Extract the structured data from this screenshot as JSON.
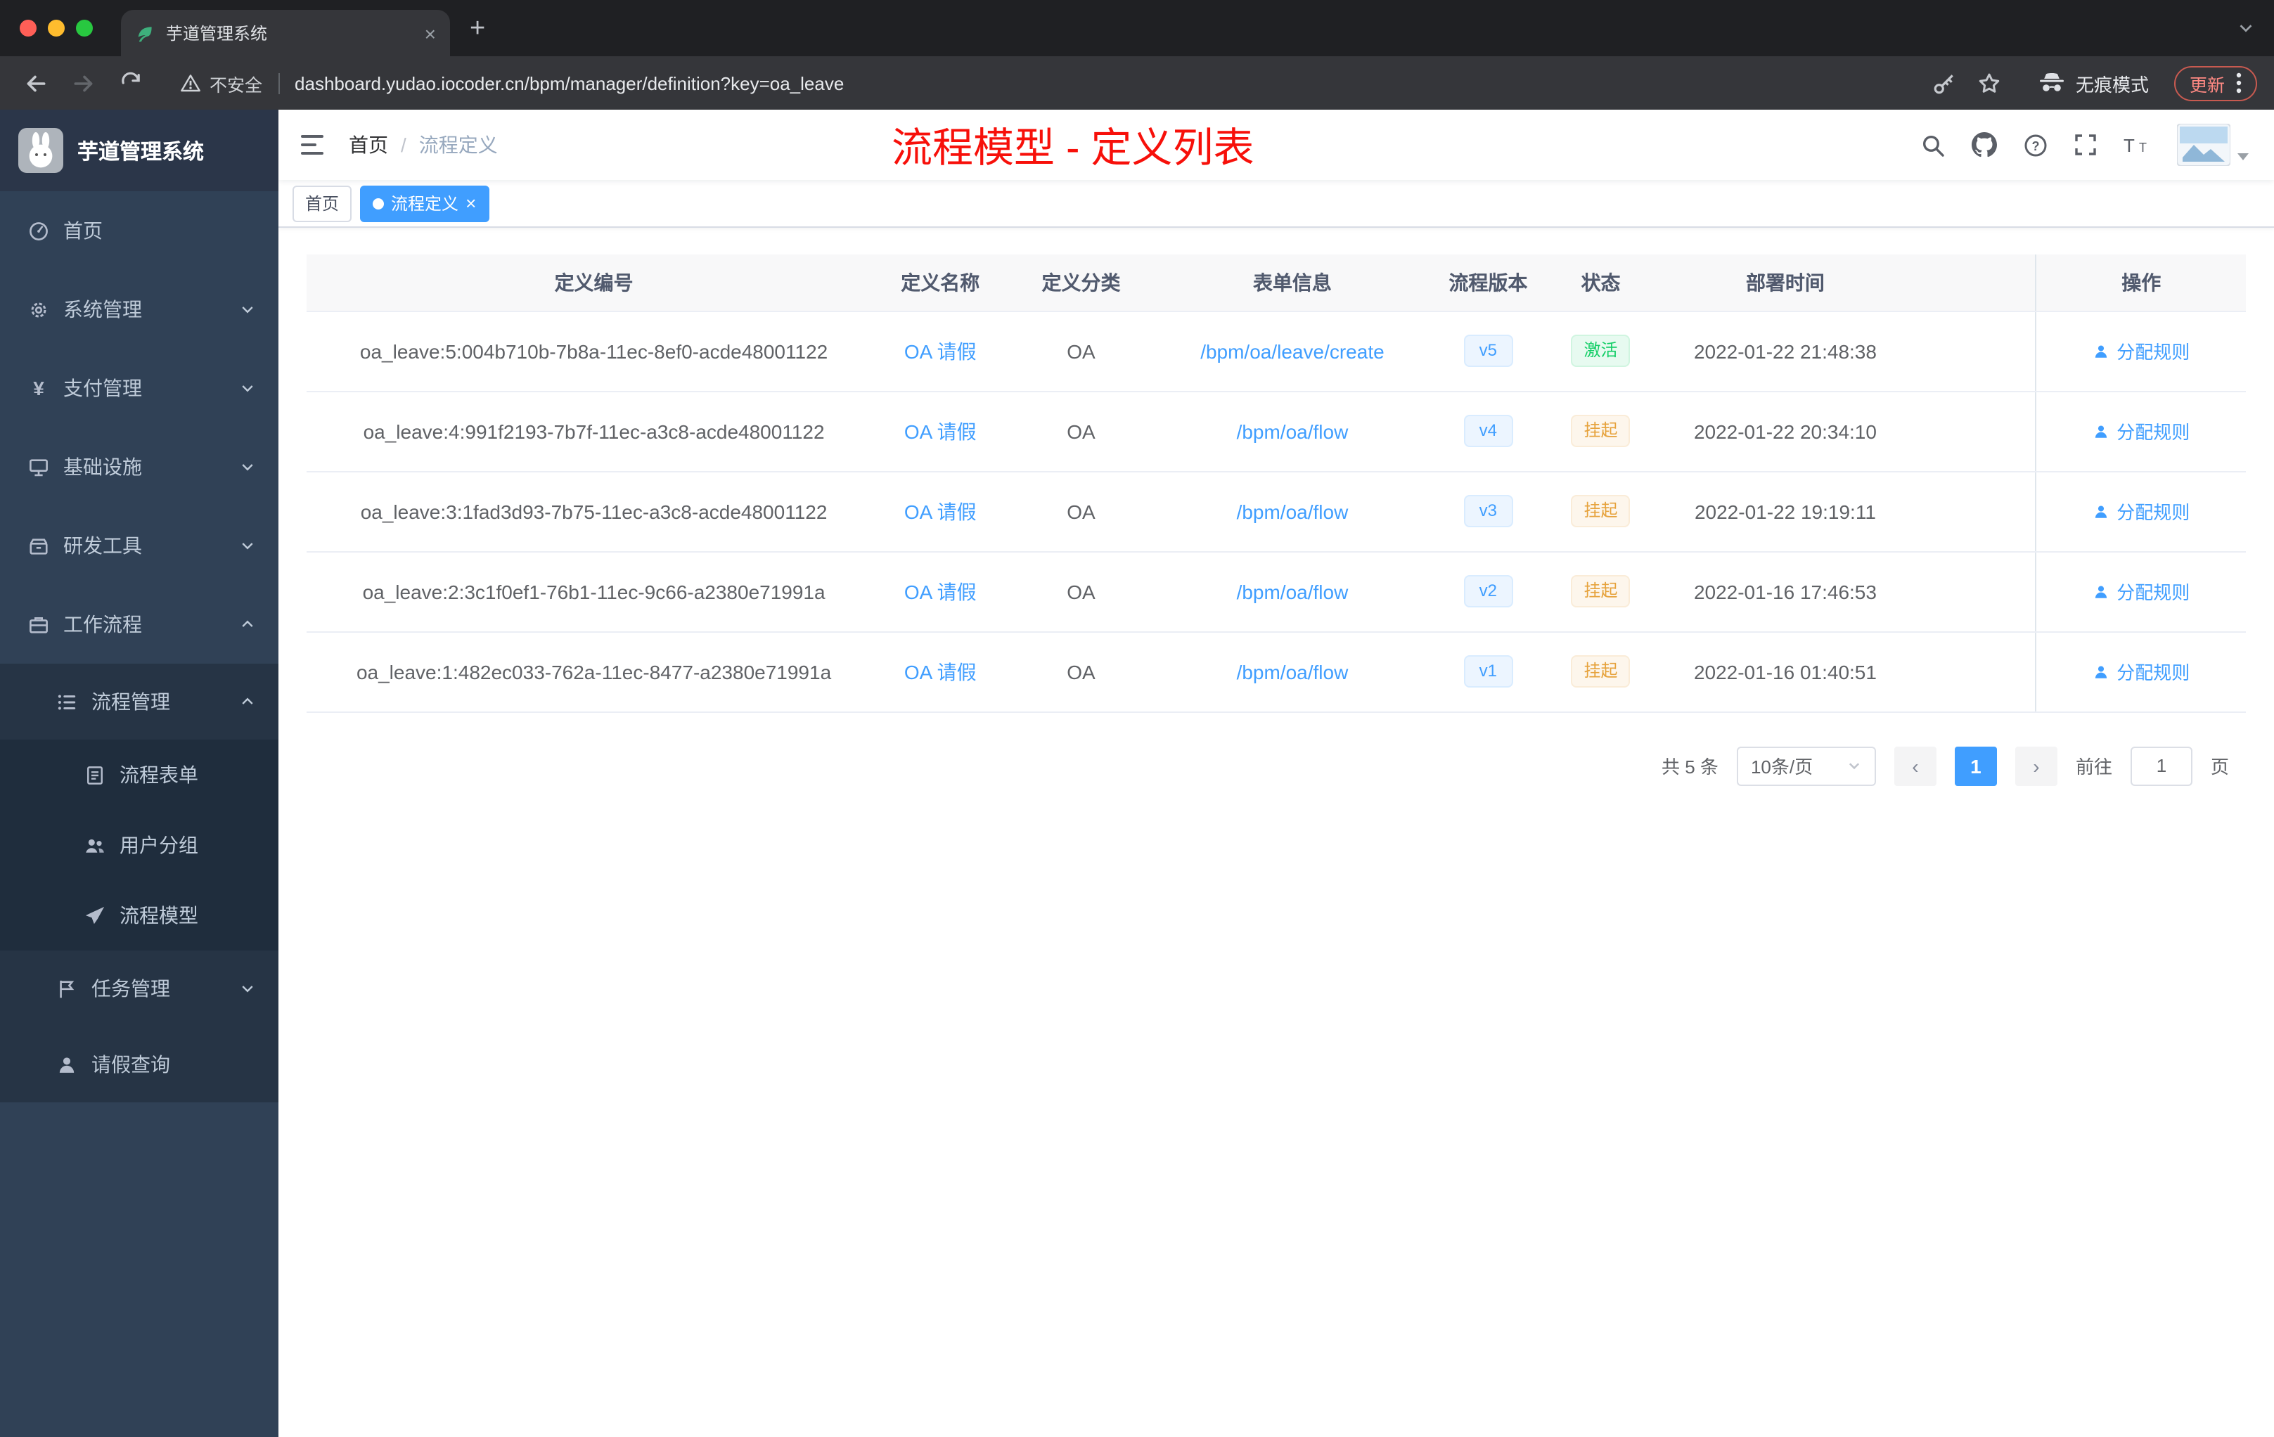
{
  "browser": {
    "tab": {
      "title": "芋道管理系统"
    },
    "address": {
      "security_label": "不安全",
      "url": "dashboard.yudao.iocoder.cn/bpm/manager/definition?key=oa_leave",
      "incognito_label": "无痕模式",
      "update_label": "更新"
    }
  },
  "sidebar": {
    "app_title": "芋道管理系统",
    "items": [
      {
        "label": "首页"
      },
      {
        "label": "系统管理"
      },
      {
        "label": "支付管理"
      },
      {
        "label": "基础设施"
      },
      {
        "label": "研发工具"
      },
      {
        "label": "工作流程"
      },
      {
        "label": "流程管理"
      },
      {
        "label": "流程表单"
      },
      {
        "label": "用户分组"
      },
      {
        "label": "流程模型"
      },
      {
        "label": "任务管理"
      },
      {
        "label": "请假查询"
      }
    ]
  },
  "header": {
    "breadcrumb": [
      "首页",
      "流程定义"
    ],
    "separator": "/",
    "page_title": "流程模型 - 定义列表"
  },
  "tags": [
    {
      "label": "首页"
    },
    {
      "label": "流程定义"
    }
  ],
  "table": {
    "columns": [
      "定义编号",
      "定义名称",
      "定义分类",
      "表单信息",
      "流程版本",
      "状态",
      "部署时间",
      "操作"
    ],
    "rows": [
      {
        "id": "oa_leave:5:004b710b-7b8a-11ec-8ef0-acde48001122",
        "name": "OA 请假",
        "category": "OA",
        "form": "/bpm/oa/leave/create",
        "version": "v5",
        "status": "激活",
        "status_type": "success",
        "deploy_time": "2022-01-22 21:48:38",
        "action": "分配规则"
      },
      {
        "id": "oa_leave:4:991f2193-7b7f-11ec-a3c8-acde48001122",
        "name": "OA 请假",
        "category": "OA",
        "form": "/bpm/oa/flow",
        "version": "v4",
        "status": "挂起",
        "status_type": "warning",
        "deploy_time": "2022-01-22 20:34:10",
        "action": "分配规则"
      },
      {
        "id": "oa_leave:3:1fad3d93-7b75-11ec-a3c8-acde48001122",
        "name": "OA 请假",
        "category": "OA",
        "form": "/bpm/oa/flow",
        "version": "v3",
        "status": "挂起",
        "status_type": "warning",
        "deploy_time": "2022-01-22 19:19:11",
        "action": "分配规则"
      },
      {
        "id": "oa_leave:2:3c1f0ef1-76b1-11ec-9c66-a2380e71991a",
        "name": "OA 请假",
        "category": "OA",
        "form": "/bpm/oa/flow",
        "version": "v2",
        "status": "挂起",
        "status_type": "warning",
        "deploy_time": "2022-01-16 17:46:53",
        "action": "分配规则"
      },
      {
        "id": "oa_leave:1:482ec033-762a-11ec-8477-a2380e71991a",
        "name": "OA 请假",
        "category": "OA",
        "form": "/bpm/oa/flow",
        "version": "v1",
        "status": "挂起",
        "status_type": "warning",
        "deploy_time": "2022-01-16 01:40:51",
        "action": "分配规则"
      }
    ]
  },
  "pagination": {
    "total_label": "共 5 条",
    "page_size_label": "10条/页",
    "current_page": "1",
    "goto_label": "前往",
    "goto_value": "1",
    "page_suffix": "页"
  },
  "colors": {
    "accent_blue": "#409eff",
    "sidebar_bg": "#304156",
    "title_red": "#f7100a",
    "success_green": "#13ce66",
    "warning_orange": "#e6a23c"
  }
}
